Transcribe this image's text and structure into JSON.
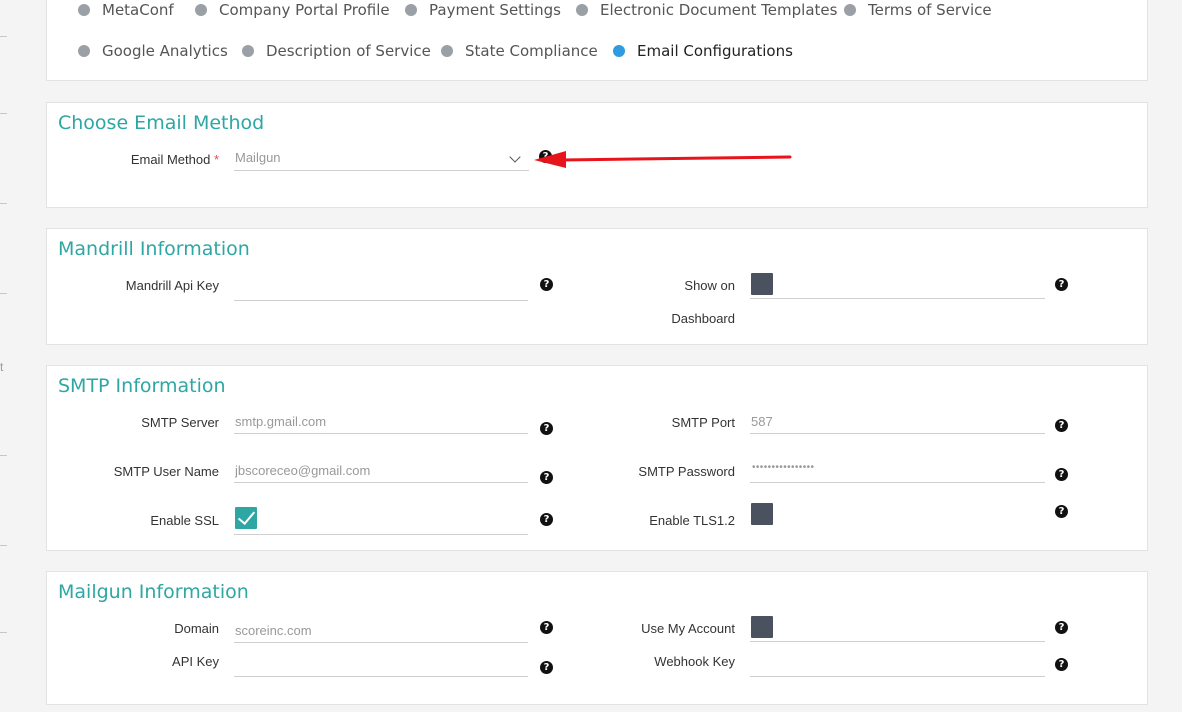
{
  "nav": {
    "items": [
      {
        "label": "MetaConf"
      },
      {
        "label": "Company Portal Profile"
      },
      {
        "label": "Payment Settings"
      },
      {
        "label": "Electronic Document Templates"
      },
      {
        "label": "Terms of Service"
      },
      {
        "label": "Google Analytics"
      },
      {
        "label": "Description of Service"
      },
      {
        "label": "State Compliance"
      },
      {
        "label": "Email Configurations",
        "active": true
      }
    ]
  },
  "email_method": {
    "title": "Choose Email Method",
    "label": "Email Method",
    "required_mark": "*",
    "value": "Mailgun"
  },
  "mandrill": {
    "title": "Mandrill Information",
    "api_key_label": "Mandrill Api Key",
    "api_key_value": "",
    "show_on_label_1": "Show on",
    "show_on_label_2": "Dashboard"
  },
  "smtp": {
    "title": "SMTP Information",
    "server_label": "SMTP Server",
    "server_placeholder": "smtp.gmail.com",
    "port_label": "SMTP Port",
    "port_placeholder": "587",
    "user_label": "SMTP User Name",
    "user_placeholder": "jbscoreceo@gmail.com",
    "password_label": "SMTP Password",
    "password_value": "••••••••••••••••",
    "ssl_label": "Enable SSL",
    "ssl_checked": true,
    "tls_label": "Enable TLS1.2",
    "tls_checked": false
  },
  "mailgun": {
    "title": "Mailgun Information",
    "domain_label": "Domain",
    "domain_placeholder": "scoreinc.com",
    "use_account_label": "Use My Account",
    "api_key_label": "API Key",
    "webhook_label": "Webhook Key"
  },
  "help_glyph": "?",
  "left_fragment": "t",
  "colors": {
    "accent_teal": "#2ea7a4",
    "active_dot": "#2f9be0",
    "checkbox_dark": "#4a5260",
    "annotation_arrow": "#e8141b"
  }
}
